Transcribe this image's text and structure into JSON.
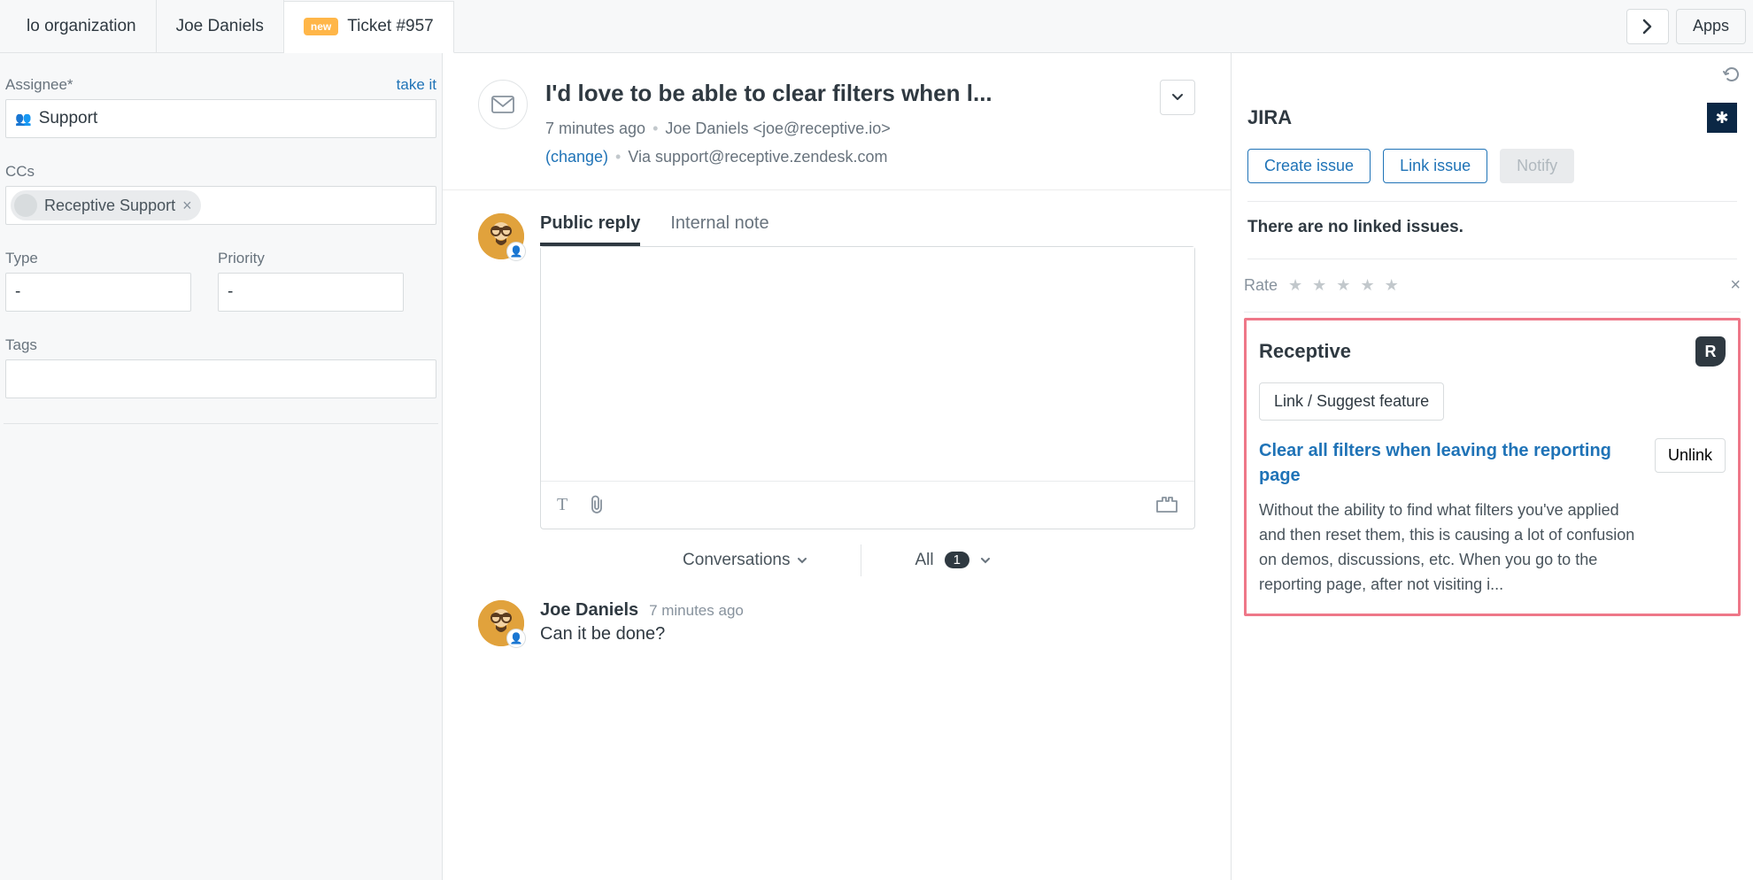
{
  "tabs": {
    "org": "lo organization",
    "user": "Joe Daniels",
    "ticket_badge": "new",
    "ticket_label": "Ticket #957"
  },
  "topbar": {
    "apps": "Apps"
  },
  "left": {
    "assignee_label": "Assignee*",
    "take_it": "take it",
    "assignee_value": "Support",
    "ccs_label": "CCs",
    "cc_chip": "Receptive Support",
    "type_label": "Type",
    "type_value": "-",
    "priority_label": "Priority",
    "priority_value": "-",
    "tags_label": "Tags"
  },
  "ticket": {
    "title": "I'd love to be able to clear filters when l...",
    "time": "7 minutes ago",
    "requester": "Joe Daniels <joe@receptive.io>",
    "change": "(change)",
    "via": "Via support@receptive.zendesk.com"
  },
  "compose": {
    "tab_public": "Public reply",
    "tab_internal": "Internal note"
  },
  "convbar": {
    "conversations": "Conversations",
    "all": "All",
    "count": "1"
  },
  "message": {
    "author": "Joe Daniels",
    "time": "7 minutes ago",
    "body": "Can it be done?"
  },
  "jira": {
    "title": "JIRA",
    "create": "Create issue",
    "link": "Link issue",
    "notify": "Notify",
    "empty": "There are no linked issues.",
    "rate": "Rate"
  },
  "receptive": {
    "title": "Receptive",
    "link_suggest": "Link / Suggest feature",
    "feature_title": "Clear all filters when leaving the reporting page",
    "feature_desc": "Without the ability to find what filters you've applied and then reset them, this is causing a lot of confusion on demos, discussions, etc. When you go to the reporting page, after not visiting i...",
    "unlink": "Unlink"
  }
}
